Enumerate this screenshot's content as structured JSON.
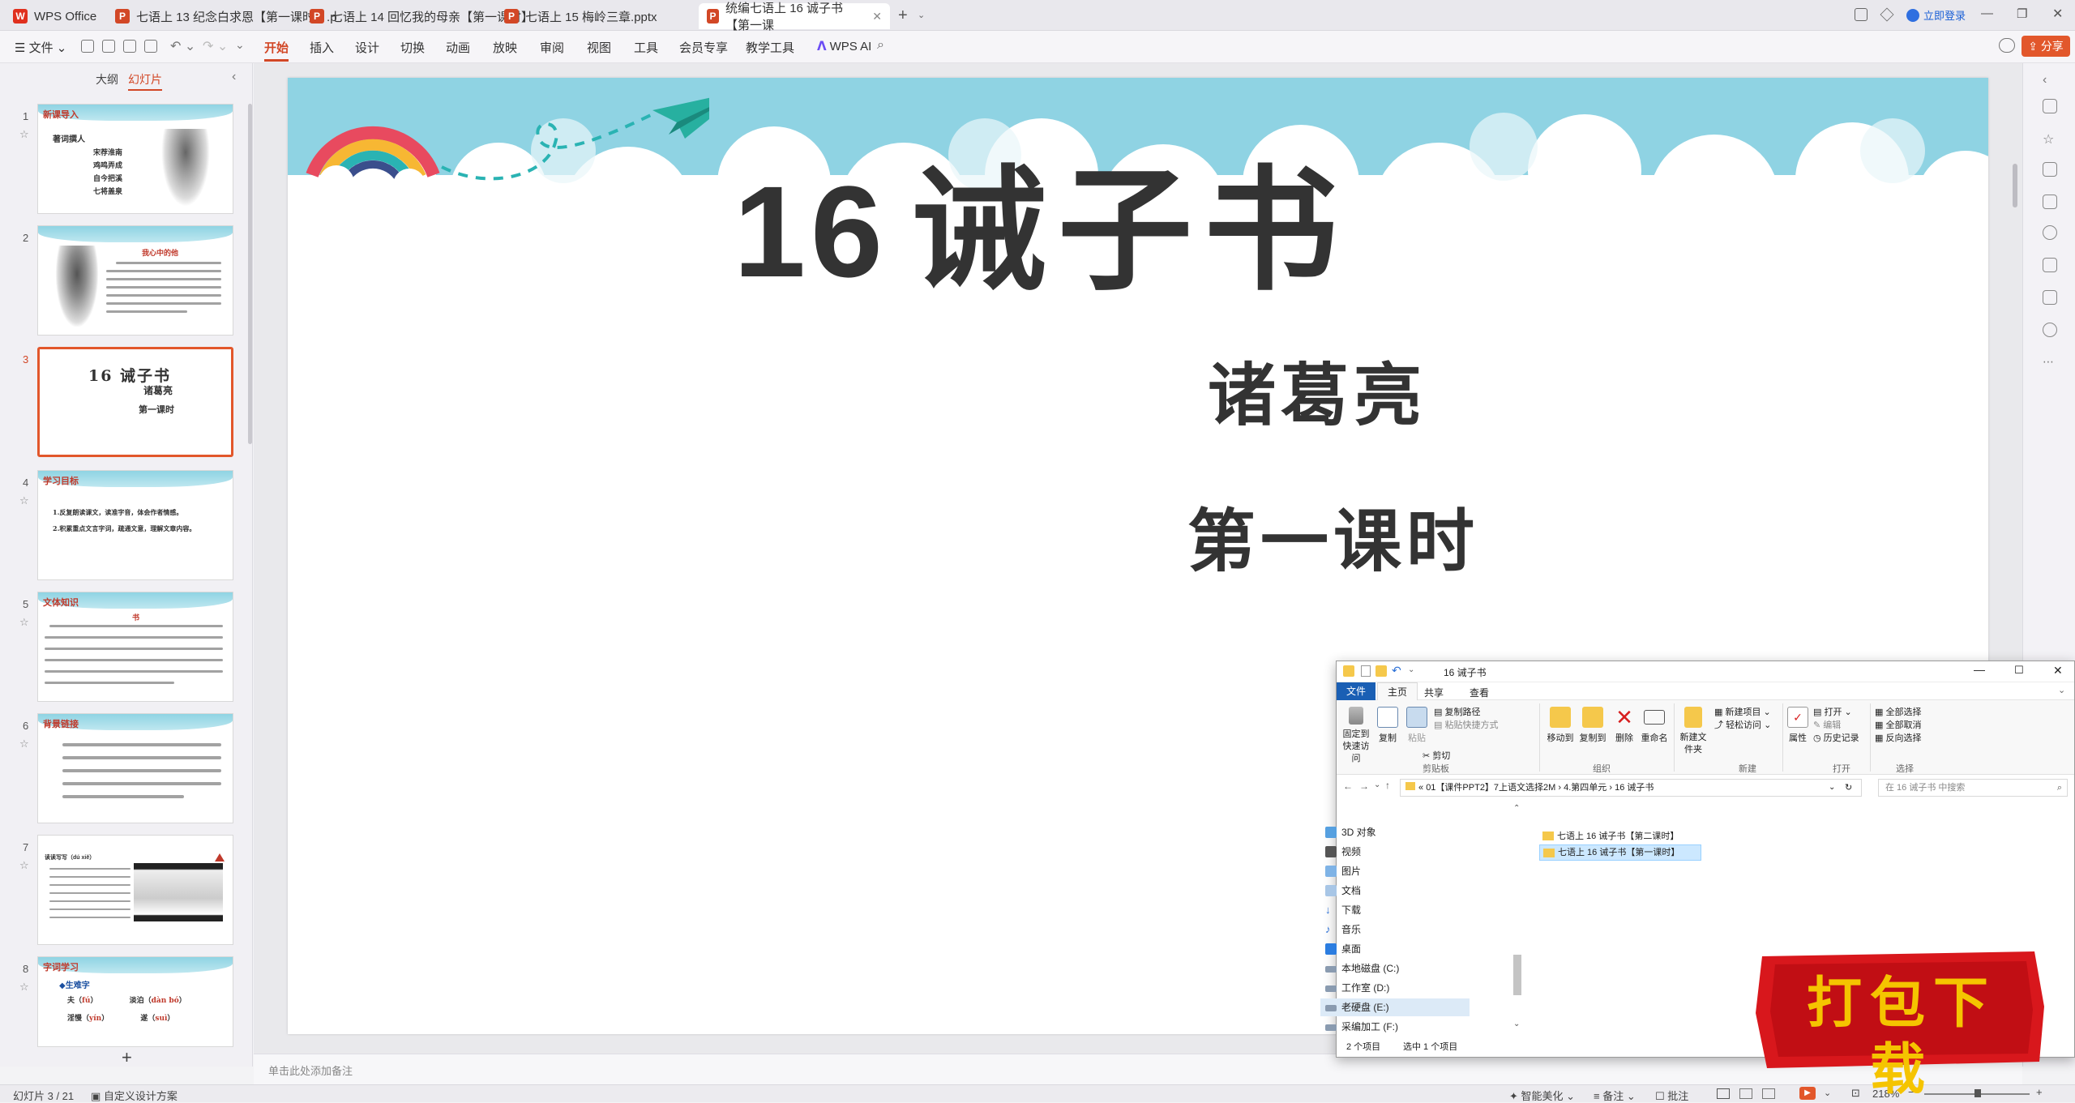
{
  "tabs": [
    {
      "label": "WPS Office",
      "icon": "wps-logo-icon"
    },
    {
      "label": "七语上 13 纪念白求恩【第一课时】.p",
      "icon": "ppt-icon"
    },
    {
      "label": "七语上 14 回忆我的母亲【第一课时】",
      "icon": "ppt-icon"
    },
    {
      "label": "七语上 15 梅岭三章.pptx",
      "icon": "ppt-icon"
    },
    {
      "label": "统编七语上 16 诚子书【第一课",
      "icon": "ppt-icon"
    }
  ],
  "titlebar": {
    "login": "立即登录"
  },
  "menubar": {
    "file": "文件",
    "items": [
      "开始",
      "插入",
      "设计",
      "切换",
      "动画",
      "放映",
      "审阅",
      "视图",
      "工具",
      "会员专享",
      "教学工具"
    ],
    "ai": "WPS AI",
    "share": "分享"
  },
  "leftpanel": {
    "tab_outline": "大纲",
    "tab_slides": "幻灯片"
  },
  "thumbnails": [
    {
      "num": "1",
      "title": "新课导入",
      "sub": "著词撰人",
      "lines": [
        "宋荐淮南",
        "鸡鸣弄成",
        "自今把溪",
        "七将盖泉"
      ]
    },
    {
      "num": "2",
      "title": "我心中的他"
    },
    {
      "num": "3",
      "title": "16 诫子书",
      "author": "诸葛亮",
      "lesson": "第一课时"
    },
    {
      "num": "4",
      "title": "学习目标",
      "lines": [
        "1.反复朗读课文，读准字音，体会作者情感。",
        "2.积累重点文言字词，疏通文意，理解文章内容。"
      ]
    },
    {
      "num": "5",
      "title": "文体知识",
      "head": "书"
    },
    {
      "num": "6",
      "title": "背景链接"
    },
    {
      "num": "7",
      "title": "读读写写（dú xiě）"
    },
    {
      "num": "8",
      "title": "字词学习",
      "sub": "◆生难字",
      "rows": [
        [
          "夫（",
          "fú",
          "）",
          "淡泊（",
          "dàn bó",
          "）"
        ],
        [
          "淫慢（",
          "yín",
          "）",
          "遂（",
          "suì",
          "）"
        ]
      ]
    }
  ],
  "slide": {
    "number": "16",
    "title": "诫子书",
    "author": "诸葛亮",
    "lesson": "第一课时"
  },
  "notes": {
    "placeholder": "单击此处添加备注"
  },
  "status": {
    "slide_info": "幻灯片 3 / 21",
    "design": "自定义设计方案",
    "beautify": "智能美化",
    "notes": "备注",
    "comment": "批注",
    "zoom": "218%"
  },
  "explorer": {
    "title": "16 诫子书",
    "ribbon_tabs": [
      "文件",
      "主页",
      "共享",
      "查看"
    ],
    "groups": {
      "clipboard": {
        "label": "剪贴板",
        "pin": "固定到快速访问",
        "copy": "复制",
        "paste": "粘贴",
        "copy_path": "复制路径",
        "paste_shortcut": "粘贴快捷方式",
        "cut": "剪切"
      },
      "organize": {
        "label": "组织",
        "move": "移动到",
        "copyto": "复制到",
        "delete": "删除",
        "rename": "重命名"
      },
      "new": {
        "label": "新建",
        "new_folder": "新建文件夹",
        "new_item": "新建项目",
        "easy_access": "轻松访问"
      },
      "open": {
        "label": "打开",
        "props": "属性",
        "open": "打开",
        "edit": "编辑",
        "history": "历史记录"
      },
      "select": {
        "label": "选择",
        "all": "全部选择",
        "none": "全部取消",
        "invert": "反向选择"
      }
    },
    "path": [
      "01【课件PPT2】7上语文选择2M",
      "4.第四单元",
      "16 诫子书"
    ],
    "search_placeholder": "在 16 诫子书 中搜索",
    "nav": [
      "3D 对象",
      "视频",
      "图片",
      "文档",
      "下载",
      "音乐",
      "桌面",
      "本地磁盘 (C:)",
      "工作室 (D:)",
      "老硬盘 (E:)",
      "采编加工 (F:)"
    ],
    "files": [
      "七语上 16 诫子书【第二课时】",
      "七语上 16 诫子书【第一课时】"
    ],
    "status_count": "2 个项目",
    "status_selected": "选中 1 个项目"
  },
  "download_badge": "打包下载",
  "colors": {
    "accent": "#d24726",
    "sky": "#8fd3e3",
    "badge_red": "#d8171c",
    "badge_gold": "#f5c400"
  }
}
